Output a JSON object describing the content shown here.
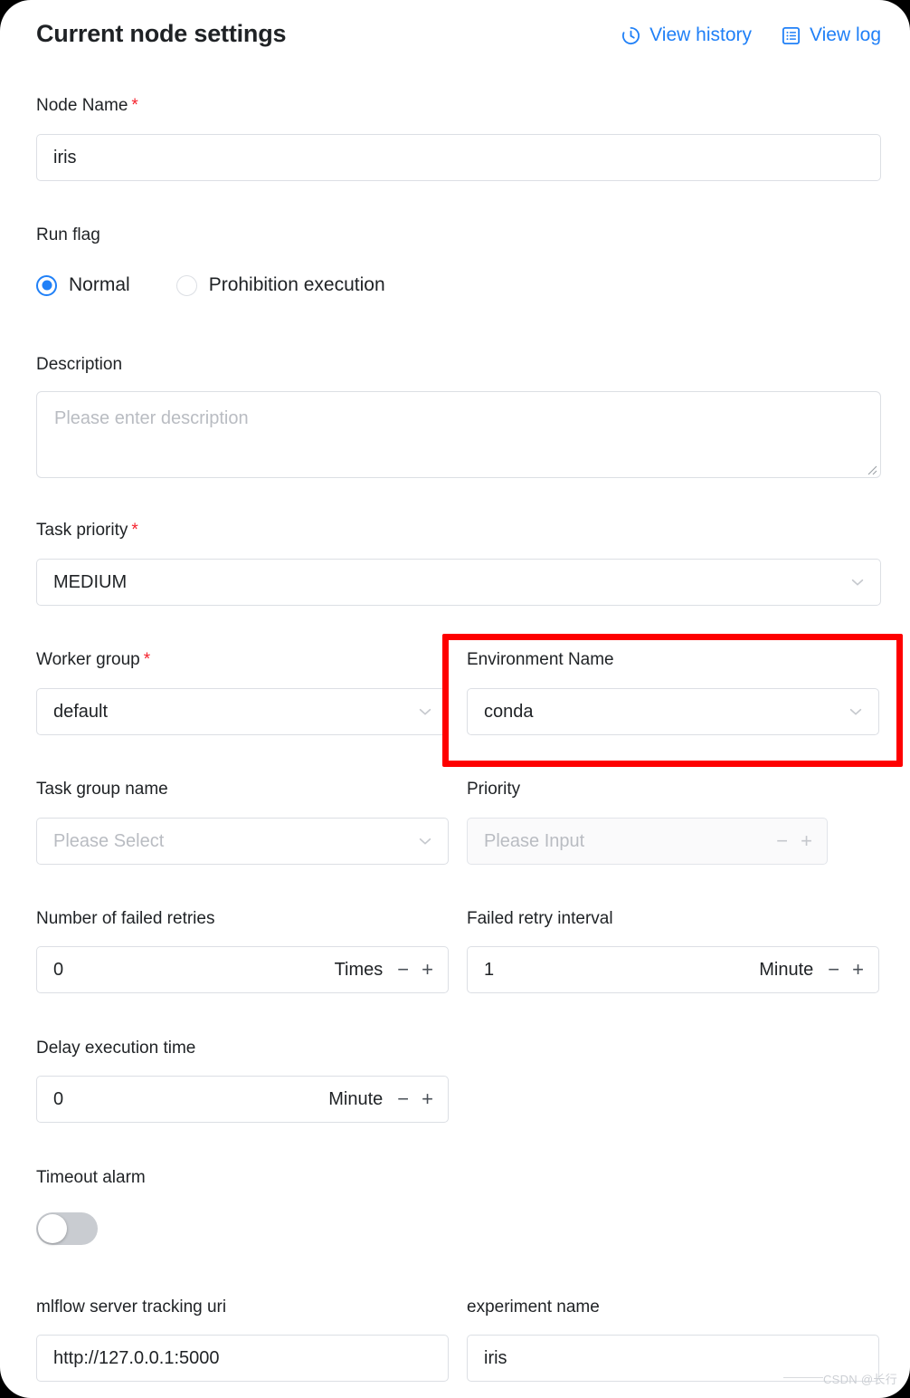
{
  "header": {
    "title": "Current node settings",
    "actions": [
      {
        "label": "View history",
        "icon": "clock-history-icon"
      },
      {
        "label": "View log",
        "icon": "document-list-icon"
      }
    ],
    "accent_color": "#2080f7"
  },
  "fields": {
    "node_name": {
      "label": "Node Name",
      "required": true,
      "required_mark": "*",
      "value": "iris"
    },
    "run_flag": {
      "label": "Run flag",
      "selected": "Normal",
      "options": [
        {
          "label": "Normal",
          "selected": true
        },
        {
          "label": "Prohibition execution",
          "selected": false
        }
      ]
    },
    "description": {
      "label": "Description",
      "value": "",
      "placeholder": "Please enter description"
    },
    "task_priority": {
      "label": "Task priority",
      "required": true,
      "required_mark": "*",
      "value": "MEDIUM",
      "icon": "chevron-down-icon"
    },
    "worker_group": {
      "label": "Worker group",
      "required": true,
      "required_mark": "*",
      "value": "default",
      "icon": "chevron-down-icon"
    },
    "environment_name": {
      "label": "Environment Name",
      "required": false,
      "value": "conda",
      "icon": "chevron-down-icon",
      "highlighted": true,
      "highlight_color": "#fe0000"
    },
    "task_group_name": {
      "label": "Task group name",
      "value": "",
      "placeholder": "Please Select",
      "icon": "chevron-down-icon"
    },
    "priority": {
      "label": "Priority",
      "value": "",
      "placeholder": "Please Input",
      "disabled": true,
      "minus_label": "−",
      "plus_label": "+"
    },
    "failed_retries": {
      "label": "Number of failed retries",
      "value": "0",
      "unit": "Times",
      "minus_label": "−",
      "plus_label": "+"
    },
    "failed_retry_interval": {
      "label": "Failed retry interval",
      "value": "1",
      "unit": "Minute",
      "minus_label": "−",
      "plus_label": "+"
    },
    "delay_execution_time": {
      "label": "Delay execution time",
      "value": "0",
      "unit": "Minute",
      "minus_label": "−",
      "plus_label": "+"
    },
    "timeout_alarm": {
      "label": "Timeout alarm",
      "enabled": false
    },
    "mlflow_tracking_uri": {
      "label": "mlflow server tracking uri",
      "value": "http://127.0.0.1:5000"
    },
    "experiment_name": {
      "label": "experiment name",
      "value": "iris"
    }
  },
  "watermark": {
    "text": "CSDN @长行"
  }
}
